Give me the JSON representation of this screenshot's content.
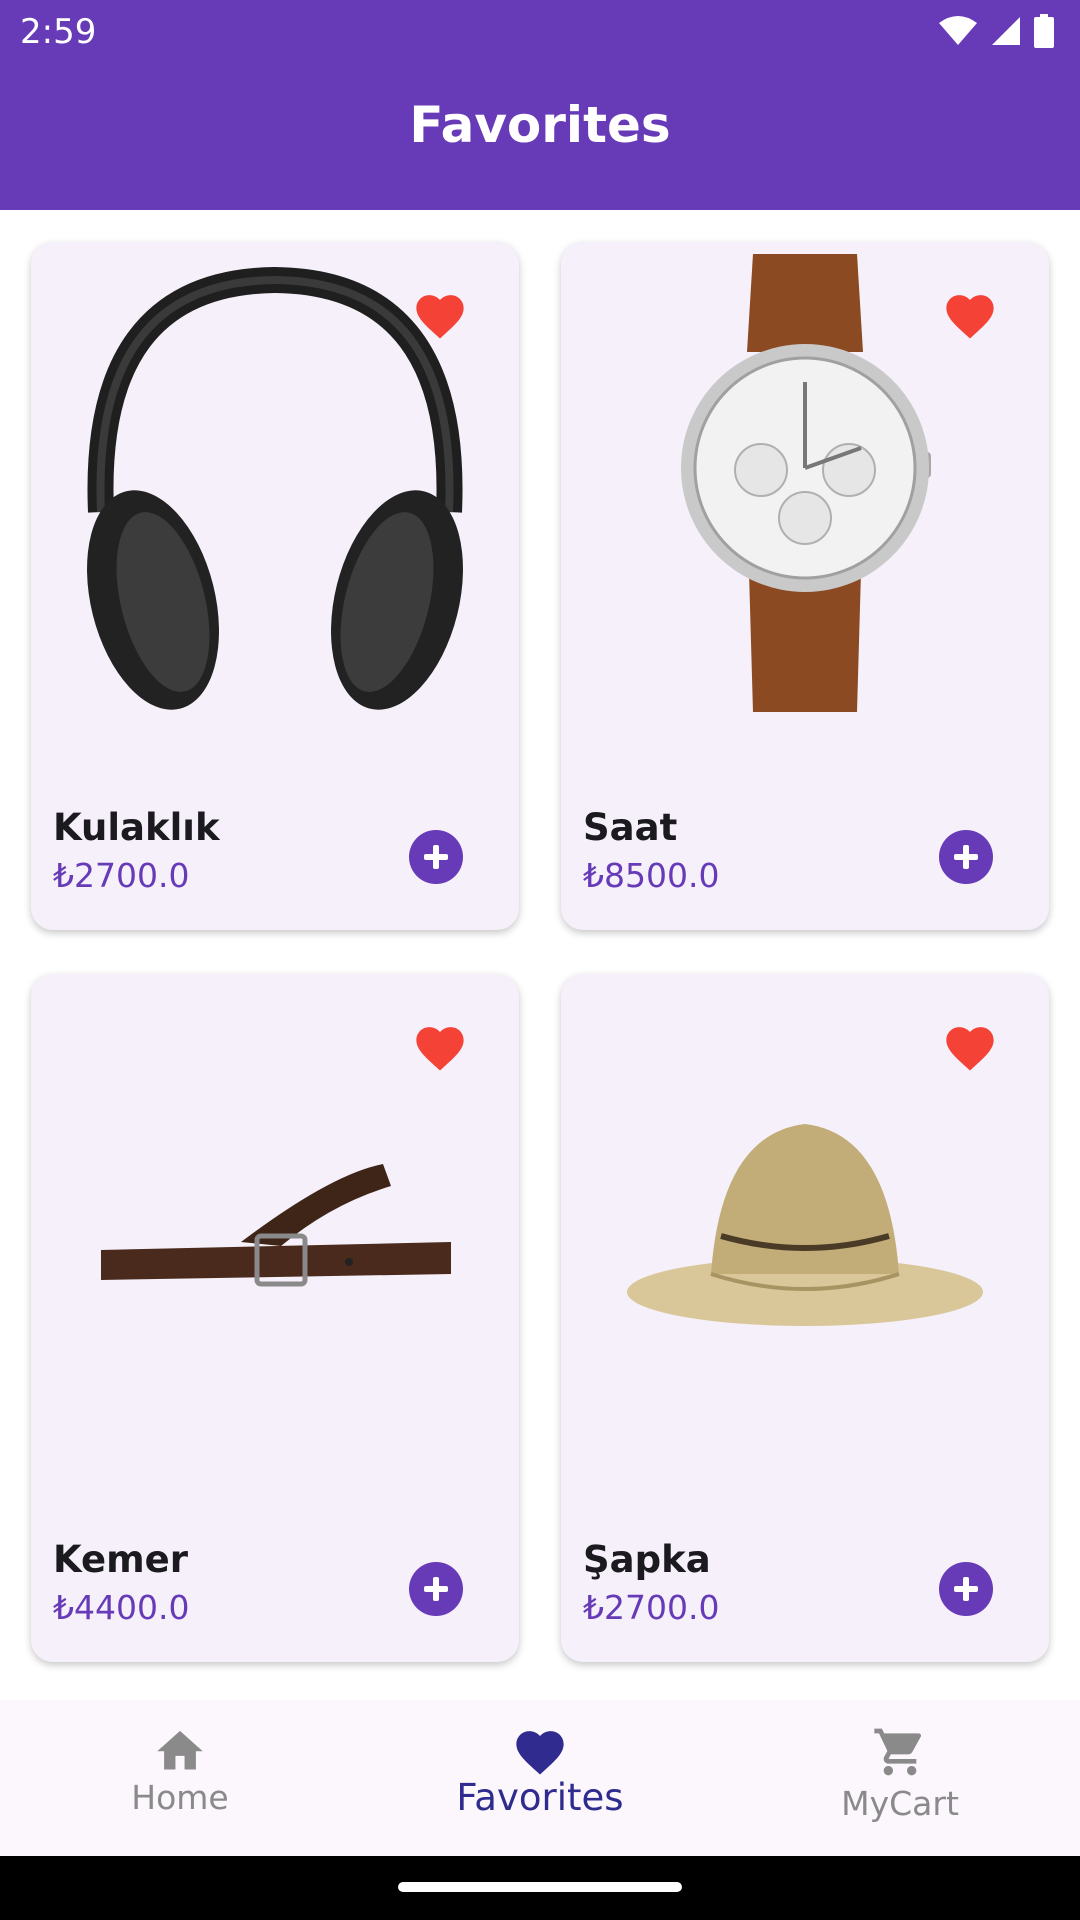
{
  "status_bar": {
    "time": "2:59"
  },
  "app_bar": {
    "title": "Favorites"
  },
  "products": [
    {
      "name": "Kulaklık",
      "price": "₺2700.0",
      "image_icon": "headphones-image",
      "favorite": true
    },
    {
      "name": "Saat",
      "price": "₺8500.0",
      "image_icon": "watch-image",
      "favorite": true
    },
    {
      "name": "Kemer",
      "price": "₺4400.0",
      "image_icon": "belt-image",
      "favorite": true
    },
    {
      "name": "Şapka",
      "price": "₺2700.0",
      "image_icon": "hat-image",
      "favorite": true
    }
  ],
  "bottom_nav": {
    "items": [
      {
        "label": "Home",
        "icon": "home-icon",
        "active": false
      },
      {
        "label": "Favorites",
        "icon": "heart-icon",
        "active": true
      },
      {
        "label": "MyCart",
        "icon": "cart-icon",
        "active": false
      }
    ]
  },
  "colors": {
    "primary": "#673ab7",
    "card_bg": "#f5f0f9",
    "heart": "#f44336",
    "nav_active": "#2f2b8f",
    "nav_inactive": "#8a8a8a"
  }
}
